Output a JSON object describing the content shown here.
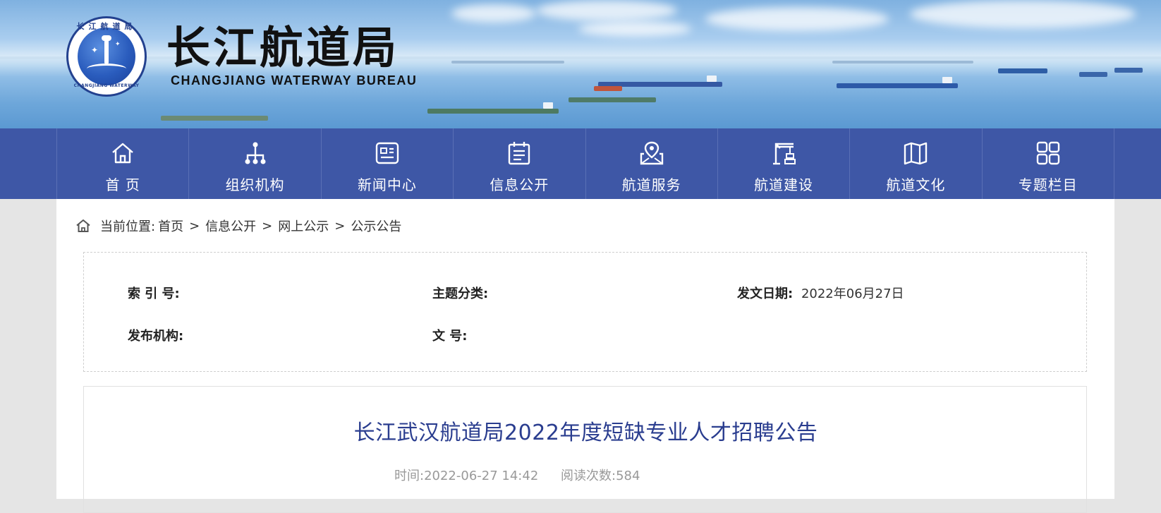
{
  "header": {
    "title_cn": "长江航道局",
    "title_en": "CHANGJIANG WATERWAY BUREAU",
    "logo": {
      "ring_top": "长江航道局",
      "ring_bottom": "CHANGJIANG WATERWAY"
    }
  },
  "nav": {
    "items": [
      {
        "label": "首 页",
        "icon": "home-icon"
      },
      {
        "label": "组织机构",
        "icon": "org-chart-icon"
      },
      {
        "label": "新闻中心",
        "icon": "news-icon"
      },
      {
        "label": "信息公开",
        "icon": "calendar-doc-icon"
      },
      {
        "label": "航道服务",
        "icon": "map-pin-icon"
      },
      {
        "label": "航道建设",
        "icon": "crane-icon"
      },
      {
        "label": "航道文化",
        "icon": "book-map-icon"
      },
      {
        "label": "专题栏目",
        "icon": "grid-icon"
      }
    ],
    "bg_color": "#3e57a6"
  },
  "breadcrumb": {
    "prefix": "当前位置:",
    "items": [
      "首页",
      "信息公开",
      "网上公示",
      "公示公告"
    ],
    "separator": ">"
  },
  "meta": {
    "index_label": "索 引 号:",
    "index_value": "",
    "topic_label": "主题分类:",
    "topic_value": "",
    "date_label": "发文日期:",
    "date_value": "2022年06月27日",
    "org_label": "发布机构:",
    "org_value": "",
    "doc_no_label": "文 号:",
    "doc_no_value": ""
  },
  "article": {
    "title": "长江武汉航道局2022年度短缺专业人才招聘公告",
    "time_label": "时间:",
    "time_value": "2022-06-27 14:42",
    "reads_label": "阅读次数:",
    "reads_value": "584",
    "title_color": "#2a3d8f"
  }
}
